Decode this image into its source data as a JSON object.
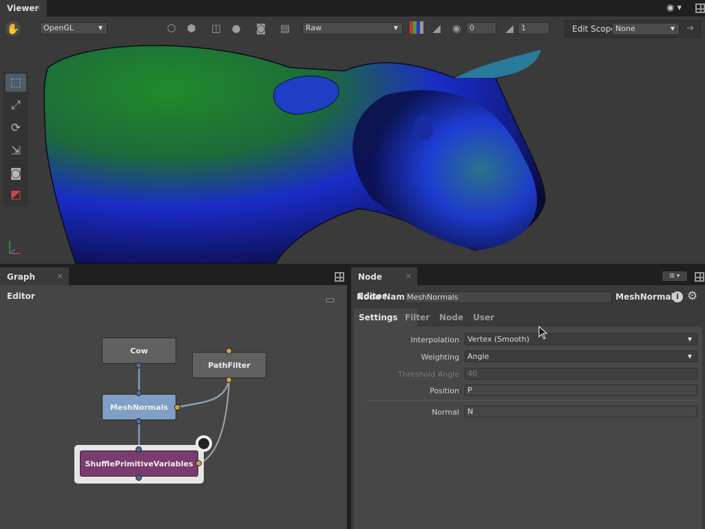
{
  "viewer": {
    "tab_label": "Viewer",
    "renderer": "OpenGL",
    "display_transform": "Raw",
    "exposure": "0",
    "gamma": "1",
    "edit_scope_label": "Edit Scope",
    "edit_scope_value": "None"
  },
  "graph_editor": {
    "tab_label": "Graph Editor",
    "nodes": {
      "cow": "Cow",
      "path_filter": "PathFilter",
      "mesh_normals": "MeshNormals",
      "shuffle": "ShufflePrimitiveVariables"
    }
  },
  "node_editor": {
    "tab_label": "Node Editor",
    "node_name_label": "Node Name",
    "node_name_value": "MeshNormals",
    "node_type": "MeshNormals",
    "tabs": [
      "Settings",
      "Filter",
      "Node",
      "User"
    ],
    "active_tab": "Settings",
    "params": {
      "interpolation": {
        "label": "Interpolation",
        "value": "Vertex (Smooth)"
      },
      "weighting": {
        "label": "Weighting",
        "value": "Angle"
      },
      "threshold_angle": {
        "label": "Threshold Angle",
        "value": "40"
      },
      "position": {
        "label": "Position",
        "value": "P"
      },
      "normal": {
        "label": "Normal",
        "value": "N"
      }
    }
  },
  "colors": {
    "mesh_normals_node": "#7f9fc4",
    "shuffle_node": "#7a3b6e",
    "default_node": "#616161",
    "plug_blue": "#4c6a94",
    "plug_gold": "#c9a04a"
  }
}
